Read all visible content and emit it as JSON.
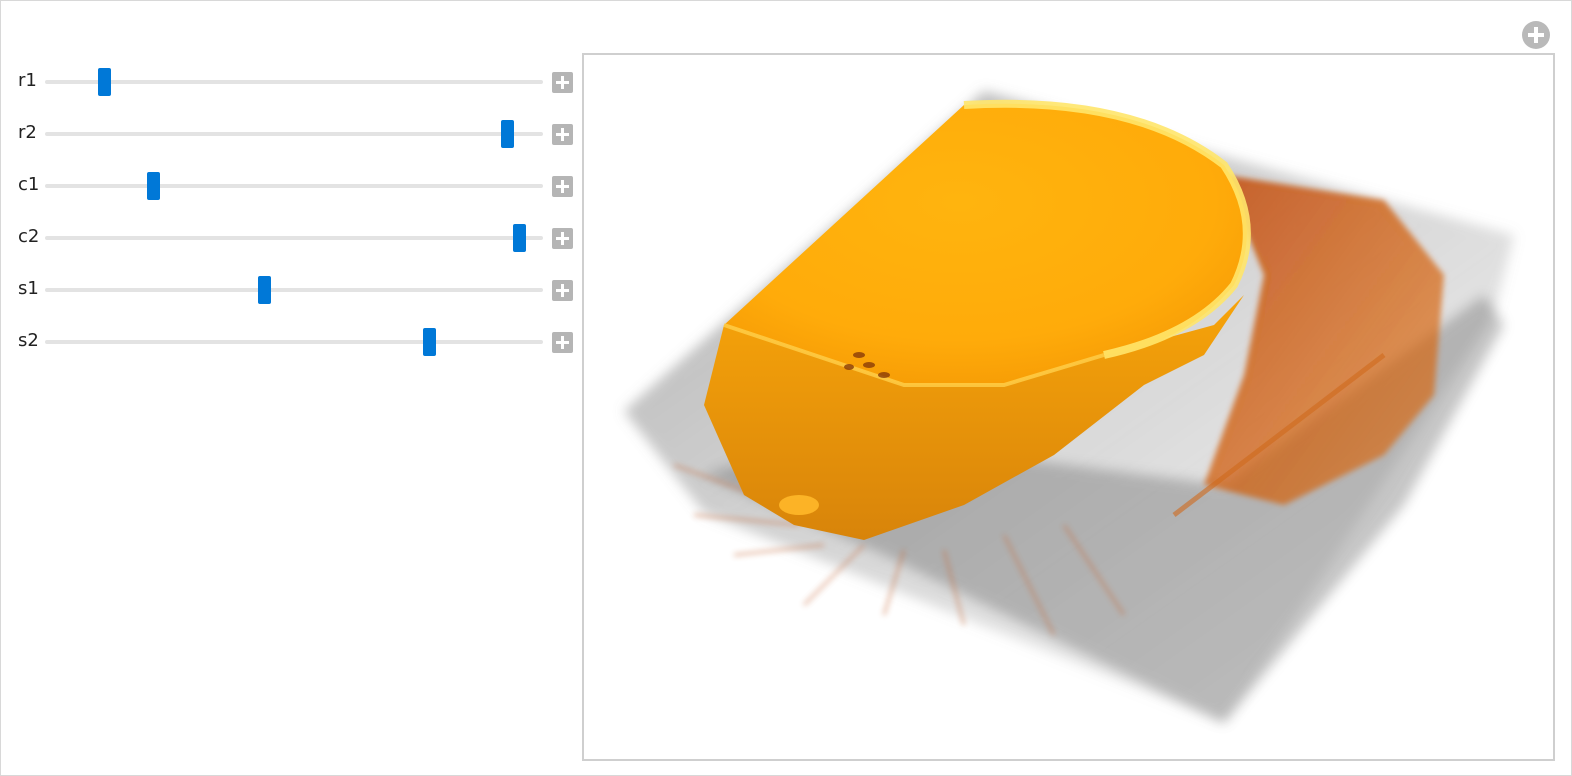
{
  "controls": [
    {
      "label": "r1",
      "position": 0.11
    },
    {
      "label": "r2",
      "position": 0.94
    },
    {
      "label": "c1",
      "position": 0.21
    },
    {
      "label": "c2",
      "position": 0.965
    },
    {
      "label": "s1",
      "position": 0.44
    },
    {
      "label": "s2",
      "position": 0.78
    }
  ],
  "volume_view": {
    "description_icon": "volume-render",
    "colors": {
      "bone": "#ffb00d",
      "bone_highlight": "#ffeb66",
      "tissue": "#e0650a",
      "haze": "#7f7f7f",
      "slider_thumb": "#0078d7"
    }
  }
}
